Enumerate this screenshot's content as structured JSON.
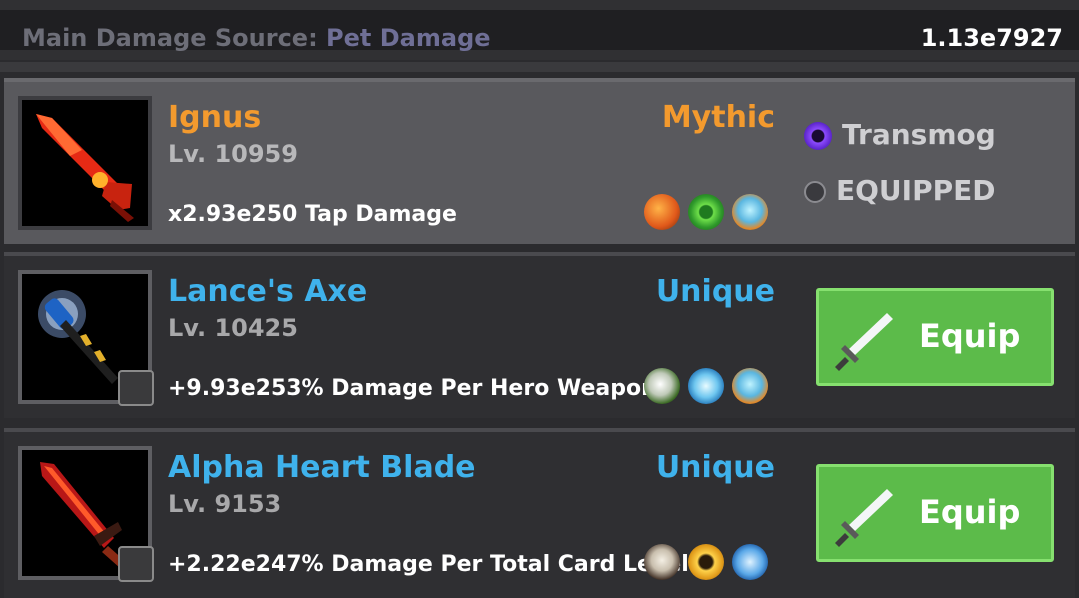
{
  "header": {
    "source_label": "Main Damage Source:",
    "source_value": "Pet Damage",
    "total_damage": "1.13e7927"
  },
  "weapons": [
    {
      "name": "Ignus",
      "level": "Lv. 10959",
      "rarity": "Mythic",
      "bonus": "x2.93e250 Tap Damage",
      "skill_icons": [
        "sword-burst-icon",
        "target-crosshair-icon",
        "crystal-gem-icon"
      ],
      "actions": {
        "transmog": "Transmog",
        "equipped": "EQUIPPED"
      }
    },
    {
      "name": "Lance's Axe",
      "level": "Lv. 10425",
      "rarity": "Unique",
      "bonus": "+9.93e253% Damage Per Hero Weapon",
      "skill_icons": [
        "shadow-warrior-icon",
        "ice-shards-icon",
        "crystal-gem-icon"
      ],
      "locked": true,
      "equip_label": "Equip"
    },
    {
      "name": "Alpha Heart Blade",
      "level": "Lv. 9153",
      "rarity": "Unique",
      "bonus": "+2.22e247% Damage Per Total Card Level",
      "skill_icons": [
        "beast-icon",
        "golden-slash-icon",
        "scroll-icon"
      ],
      "locked": true,
      "equip_label": "Equip"
    }
  ],
  "colors": {
    "mythic": "#f39a2e",
    "unique": "#3fb2ec",
    "equip_button": "#5cbb4a",
    "transmog_icon": "#7a3df0"
  }
}
